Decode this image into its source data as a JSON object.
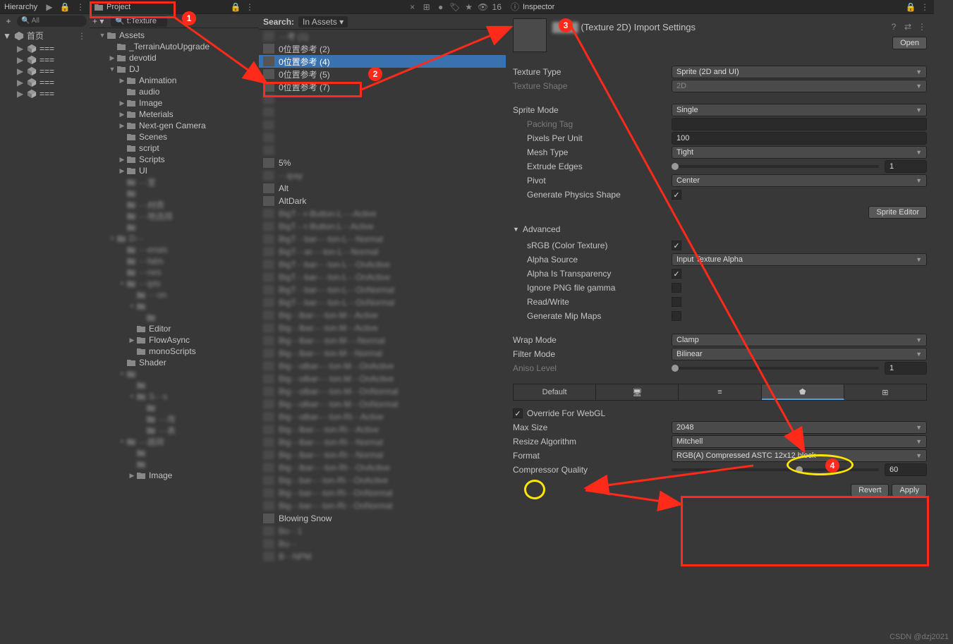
{
  "hierarchy": {
    "title": "Hierarchy",
    "search_label": "All",
    "root": "首页",
    "items": [
      "===",
      "===",
      "===",
      "===",
      "==="
    ]
  },
  "project": {
    "title": "Project",
    "search_value": "t:Texture",
    "hidden_count": "16",
    "tree": [
      {
        "d": 1,
        "arrow": "▼",
        "label": "Assets"
      },
      {
        "d": 2,
        "arrow": "",
        "label": "_TerrainAutoUpgrade"
      },
      {
        "d": 2,
        "arrow": "▶",
        "label": "devotid"
      },
      {
        "d": 2,
        "arrow": "▼",
        "label": "DJ"
      },
      {
        "d": 3,
        "arrow": "▶",
        "label": "Animation"
      },
      {
        "d": 3,
        "arrow": "",
        "label": "audio"
      },
      {
        "d": 3,
        "arrow": "▶",
        "label": "Image"
      },
      {
        "d": 3,
        "arrow": "▶",
        "label": "Meterials"
      },
      {
        "d": 3,
        "arrow": "▶",
        "label": "Next-gen Camera"
      },
      {
        "d": 3,
        "arrow": "",
        "label": "Scenes"
      },
      {
        "d": 3,
        "arrow": "",
        "label": "script"
      },
      {
        "d": 3,
        "arrow": "▶",
        "label": "Scripts"
      },
      {
        "d": 3,
        "arrow": "▶",
        "label": "UI"
      },
      {
        "d": 3,
        "arrow": "",
        "label": "···室",
        "pix": true
      },
      {
        "d": 3,
        "arrow": "",
        "label": "",
        "pix": true
      },
      {
        "d": 3,
        "arrow": "",
        "label": "···材质",
        "pix": true
      },
      {
        "d": 3,
        "arrow": "",
        "label": "···地选择",
        "pix": true
      },
      {
        "d": 3,
        "arrow": "",
        "label": "",
        "pix": true
      },
      {
        "d": 2,
        "arrow": "▼",
        "label": "D···",
        "pix": true
      },
      {
        "d": 3,
        "arrow": "",
        "label": "···erials",
        "pix": true
      },
      {
        "d": 3,
        "arrow": "",
        "label": "···fabs",
        "pix": true
      },
      {
        "d": 3,
        "arrow": "",
        "label": "···nes",
        "pix": true
      },
      {
        "d": 3,
        "arrow": "▼",
        "label": "···ipts",
        "pix": true
      },
      {
        "d": 4,
        "arrow": "",
        "label": "···on",
        "pix": true
      },
      {
        "d": 4,
        "arrow": "▼",
        "label": "",
        "pix": true
      },
      {
        "d": 5,
        "arrow": "",
        "label": "",
        "pix": true
      },
      {
        "d": 4,
        "arrow": "",
        "label": "Editor"
      },
      {
        "d": 4,
        "arrow": "▶",
        "label": "FlowAsync"
      },
      {
        "d": 4,
        "arrow": "",
        "label": "monoScripts"
      },
      {
        "d": 3,
        "arrow": "",
        "label": "Shader"
      },
      {
        "d": 3,
        "arrow": "▼",
        "label": "",
        "pix": true
      },
      {
        "d": 4,
        "arrow": "",
        "label": "",
        "pix": true
      },
      {
        "d": 4,
        "arrow": "▼",
        "label": "S···s",
        "pix": true
      },
      {
        "d": 5,
        "arrow": "",
        "label": "",
        "pix": true
      },
      {
        "d": 5,
        "arrow": "",
        "label": "···传",
        "pix": true
      },
      {
        "d": 5,
        "arrow": "",
        "label": "···表",
        "pix": true
      },
      {
        "d": 3,
        "arrow": "▼",
        "label": "···跳转",
        "pix": true
      },
      {
        "d": 4,
        "arrow": "",
        "label": "",
        "pix": true
      },
      {
        "d": 4,
        "arrow": "",
        "label": "",
        "pix": true
      },
      {
        "d": 4,
        "arrow": "▶",
        "label": "Image"
      }
    ]
  },
  "search_results": {
    "label": "Search:",
    "scope": "In Assets",
    "items": [
      {
        "t": "···考 (1)",
        "pix": true
      },
      {
        "t": "0位置参考 (2)"
      },
      {
        "t": "0位置参考 (4)",
        "sel": true
      },
      {
        "t": "0位置参考 (5)"
      },
      {
        "t": "0位置参考 (7)"
      },
      {
        "t": "",
        "pix": true
      },
      {
        "t": "",
        "pix": true
      },
      {
        "t": "",
        "pix": true
      },
      {
        "t": "",
        "pix": true
      },
      {
        "t": "",
        "pix": true
      },
      {
        "t": "5%"
      },
      {
        "t": "···ipay",
        "pix": true
      },
      {
        "t": "Alt"
      },
      {
        "t": "AltDark"
      },
      {
        "t": "BigT···r-Button-L···-Active",
        "pix": true
      },
      {
        "t": "BigT···r-Button-L···Active",
        "pix": true
      },
      {
        "t": "BigT···bar-···ton-L···Normal",
        "pix": true
      },
      {
        "t": "BigT···ar-···ton-L···Normal",
        "pix": true
      },
      {
        "t": "BigT···bar-···ton-L···OnActive",
        "pix": true
      },
      {
        "t": "BigT···bar-···ton-L···OnActive",
        "pix": true
      },
      {
        "t": "BigT···bar-···ton-L···OnNormal",
        "pix": true
      },
      {
        "t": "BigT···bar-···ton-L···OnNormal",
        "pix": true
      },
      {
        "t": "Big···lbar-···ton-M···Active",
        "pix": true
      },
      {
        "t": "Big···lbar-···ton-M···Active",
        "pix": true
      },
      {
        "t": "Big···lbar-···ton-M···-Normal",
        "pix": true
      },
      {
        "t": "Big···lbar-···ton-M···Normal",
        "pix": true
      },
      {
        "t": "Big···olbar-···ton-M···OnActive",
        "pix": true
      },
      {
        "t": "Big···olbar-···ton-M···OnActive",
        "pix": true
      },
      {
        "t": "Big···olbar-···ton-M···OnNormal",
        "pix": true
      },
      {
        "t": "Big···olbar-···ton-M···OnNormal",
        "pix": true
      },
      {
        "t": "Big···olbar-···ton-Ri···Active",
        "pix": true
      },
      {
        "t": "Big···lbar-···ton-Ri···Active",
        "pix": true
      },
      {
        "t": "Big···lbar-···ton-Ri···Normal",
        "pix": true
      },
      {
        "t": "Big···lbar-···ton-Ri···Normal",
        "pix": true
      },
      {
        "t": "Big···lbar-···ton-Ri···OnActive",
        "pix": true
      },
      {
        "t": "Big···bar-···ton-Ri···OnActive",
        "pix": true
      },
      {
        "t": "Big···bar-···ton-Ri···OnNormal",
        "pix": true
      },
      {
        "t": "Big···bar-···ton-Ri···OnNormal",
        "pix": true
      },
      {
        "t": "Blowing Snow"
      },
      {
        "t": "Bo···1",
        "pix": true
      },
      {
        "t": "Bu···",
        "pix": true
      },
      {
        "t": "B···NPM",
        "pix": true
      }
    ]
  },
  "inspector": {
    "title": "Inspector",
    "name_suffix": "(Texture 2D) Import Settings",
    "open": "Open",
    "textureType": {
      "label": "Texture Type",
      "value": "Sprite (2D and UI)"
    },
    "textureShape": {
      "label": "Texture Shape",
      "value": "2D"
    },
    "spriteMode": {
      "label": "Sprite Mode",
      "value": "Single"
    },
    "packingTag": {
      "label": "Packing Tag",
      "value": ""
    },
    "ppu": {
      "label": "Pixels Per Unit",
      "value": "100"
    },
    "meshType": {
      "label": "Mesh Type",
      "value": "Tight"
    },
    "extrude": {
      "label": "Extrude Edges",
      "value": "1"
    },
    "pivot": {
      "label": "Pivot",
      "value": "Center"
    },
    "genPhys": {
      "label": "Generate Physics Shape"
    },
    "spriteEditor": "Sprite Editor",
    "advanced": "Advanced",
    "srgb": {
      "label": "sRGB (Color Texture)"
    },
    "alphaSource": {
      "label": "Alpha Source",
      "value": "Input Texture Alpha"
    },
    "alphaTrans": {
      "label": "Alpha Is Transparency"
    },
    "ignoreGamma": {
      "label": "Ignore PNG file gamma"
    },
    "readWrite": {
      "label": "Read/Write"
    },
    "genMip": {
      "label": "Generate Mip Maps"
    },
    "wrap": {
      "label": "Wrap Mode",
      "value": "Clamp"
    },
    "filter": {
      "label": "Filter Mode",
      "value": "Bilinear"
    },
    "aniso": {
      "label": "Aniso Level",
      "value": "1"
    },
    "platforms": {
      "default": "Default"
    },
    "override": {
      "label": "Override For WebGL"
    },
    "maxSize": {
      "label": "Max Size",
      "value": "2048"
    },
    "resize": {
      "label": "Resize Algorithm",
      "value": "Mitchell"
    },
    "format": {
      "label": "Format",
      "value": "RGB(A) Compressed ASTC 12x12 block"
    },
    "quality": {
      "label": "Compressor Quality",
      "value": "60"
    },
    "revert": "Revert",
    "apply": "Apply"
  },
  "watermark": "CSDN @dzj2021",
  "annotations": {
    "n1": "1",
    "n2": "2",
    "n3": "3",
    "n4": "4"
  }
}
